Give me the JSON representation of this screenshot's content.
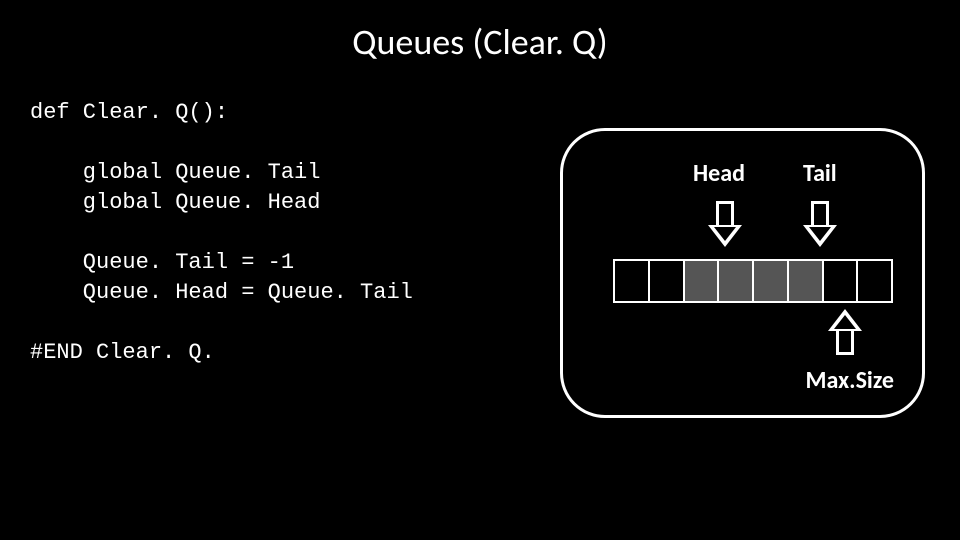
{
  "title": "Queues (Clear. Q)",
  "code": {
    "line1": "def Clear. Q():",
    "line2": "",
    "line3": "    global Queue. Tail",
    "line4": "    global Queue. Head",
    "line5": "",
    "line6": "    Queue. Tail = -1",
    "line7": "    Queue. Head = Queue. Tail",
    "line8": "",
    "line9": "#END Clear. Q."
  },
  "diagram": {
    "head_label": "Head",
    "tail_label": "Tail",
    "maxsize_label": "Max.Size",
    "cells": [
      false,
      false,
      true,
      true,
      true,
      true,
      false,
      false
    ]
  },
  "chart_data": {
    "type": "table",
    "title": "Queue array state diagram",
    "cells_filled": [
      0,
      0,
      1,
      1,
      1,
      1,
      0,
      0
    ],
    "head_index_visual": 2,
    "tail_index_visual": 5,
    "max_size_index_visual": 7,
    "max_size": 8
  }
}
